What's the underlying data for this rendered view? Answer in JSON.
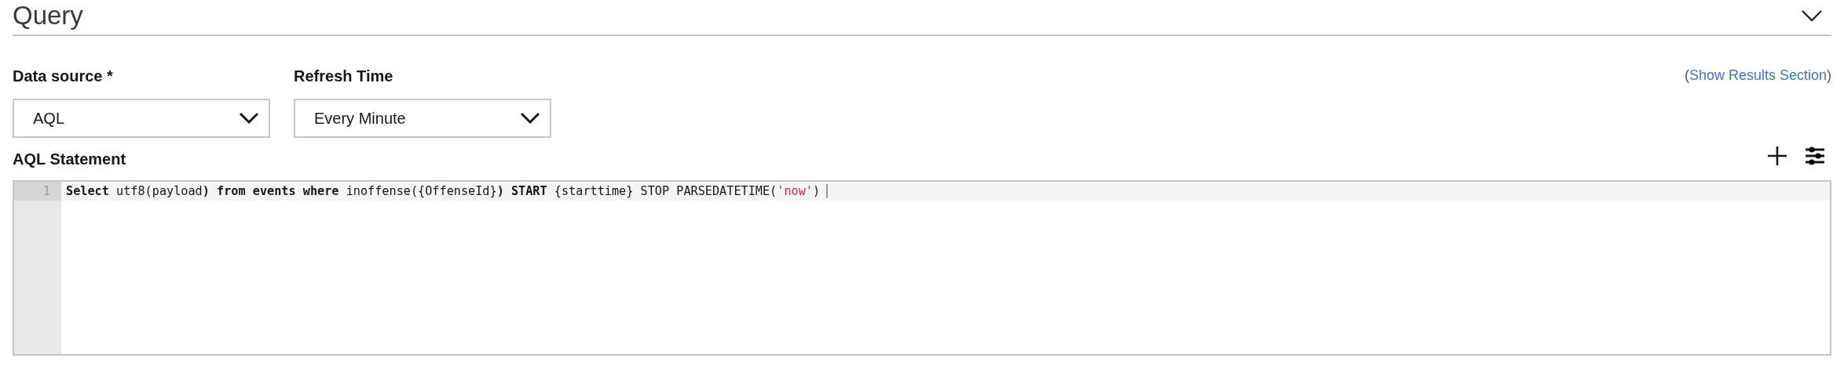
{
  "section": {
    "title": "Query",
    "expanded": true
  },
  "fields": [
    {
      "label": "Data source *",
      "value": "AQL"
    },
    {
      "label": "Refresh Time",
      "value": "Every Minute"
    }
  ],
  "results_link": {
    "open": "(",
    "text": "Show Results Section",
    "close": ")"
  },
  "statement": {
    "label": "AQL Statement",
    "lines": [
      {
        "number": "1",
        "active": true,
        "tokens": [
          {
            "kind": "keyword",
            "text": "Select"
          },
          {
            "kind": "plain",
            "text": " utf8(payload"
          },
          {
            "kind": "keyword",
            "text": ") from events where"
          },
          {
            "kind": "plain",
            "text": " inoffense({OffenseId}"
          },
          {
            "kind": "keyword",
            "text": ") START"
          },
          {
            "kind": "plain",
            "text": " {starttime} STOP PARSEDATETIME("
          },
          {
            "kind": "string",
            "text": "'now'"
          },
          {
            "kind": "plain",
            "text": ")"
          }
        ]
      }
    ]
  }
}
